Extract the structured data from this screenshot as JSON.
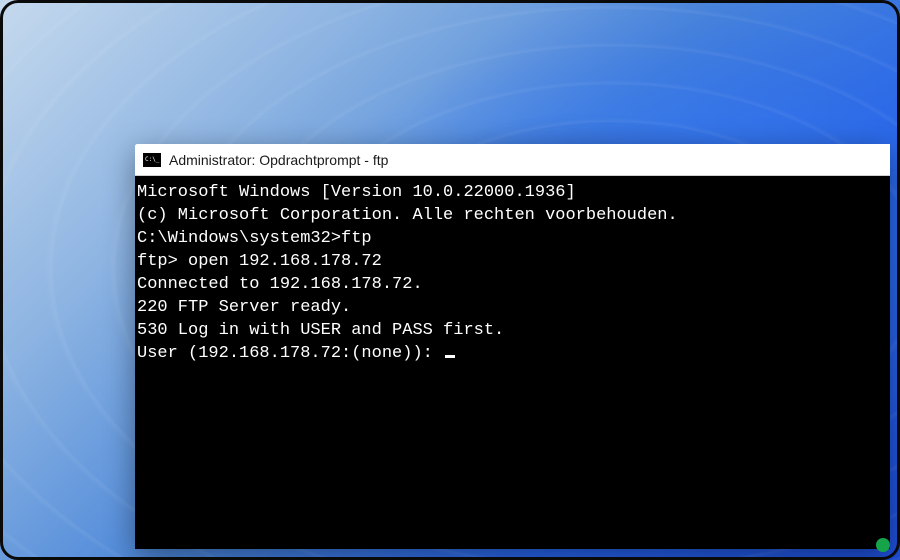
{
  "window": {
    "title": "Administrator: Opdrachtprompt - ftp",
    "icon": "cmd-icon"
  },
  "terminal": {
    "lines": [
      "Microsoft Windows [Version 10.0.22000.1936]",
      "(c) Microsoft Corporation. Alle rechten voorbehouden.",
      "",
      "C:\\Windows\\system32>ftp",
      "ftp> open 192.168.178.72",
      "Connected to 192.168.178.72.",
      "220 FTP Server ready.",
      "530 Log in with USER and PASS first.",
      "User (192.168.178.72:(none)): "
    ]
  }
}
